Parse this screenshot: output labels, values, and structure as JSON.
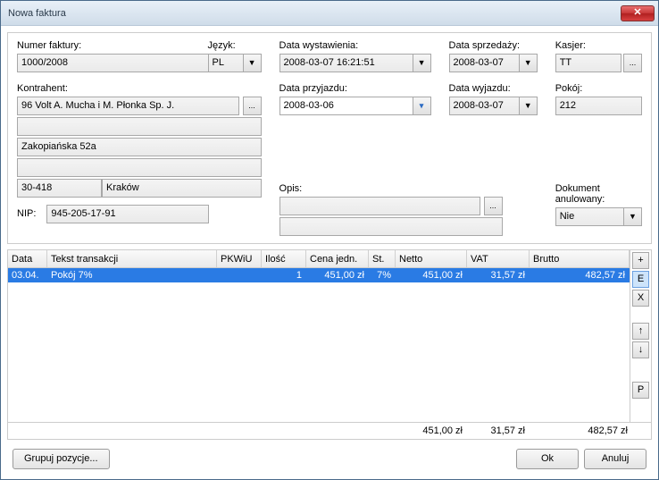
{
  "window": {
    "title": "Nowa faktura"
  },
  "labels": {
    "numer": "Numer faktury:",
    "jezyk": "Język:",
    "data_wyst": "Data wystawienia:",
    "data_sprz": "Data sprzedaży:",
    "kasjer": "Kasjer:",
    "kontrahent": "Kontrahent:",
    "data_przy": "Data przyjazdu:",
    "data_wyj": "Data wyjazdu:",
    "pokoj": "Pokój:",
    "opis": "Opis:",
    "dok_anul": "Dokument anulowany:",
    "nip": "NIP:"
  },
  "values": {
    "numer": "1000/2008",
    "jezyk": "PL",
    "data_wyst": "2008-03-07 16:21:51",
    "data_sprz": "2008-03-07",
    "kasjer": "TT",
    "kontrahent_name": "96 Volt A. Mucha i M. Płonka Sp. J.",
    "kontrahent_l2": "",
    "kontrahent_street": "Zakopiańska 52a",
    "kontrahent_l4": "",
    "kontrahent_zip": "30-418",
    "kontrahent_city": "Kraków",
    "data_przy": "2008-03-06",
    "data_wyj": "2008-03-07",
    "pokoj": "212",
    "opis1": "",
    "opis2": "",
    "dok_anul": "Nie",
    "nip": "945-205-17-91"
  },
  "grid": {
    "headers": {
      "data": "Data",
      "tekst": "Tekst transakcji",
      "pkwiu": "PKWiU",
      "ilosc": "Ilość",
      "cena": "Cena jedn.",
      "st": "St.",
      "netto": "Netto",
      "vat": "VAT",
      "brutto": "Brutto"
    },
    "rows": [
      {
        "data": "03.04.",
        "tekst": "Pokój 7%",
        "pkwiu": "",
        "ilosc": "1",
        "cena": "451,00 zł",
        "st": "7%",
        "netto": "451,00 zł",
        "vat": "31,57 zł",
        "brutto": "482,57 zł"
      }
    ],
    "totals": {
      "netto": "451,00 zł",
      "vat": "31,57 zł",
      "brutto": "482,57 zł"
    },
    "side_buttons": {
      "add": "+",
      "edit": "E",
      "del": "X",
      "up": "↑",
      "down": "↓",
      "p": "P"
    }
  },
  "footer": {
    "grupuj": "Grupuj pozycje...",
    "ok": "Ok",
    "anuluj": "Anuluj"
  },
  "ellipsis": "..."
}
